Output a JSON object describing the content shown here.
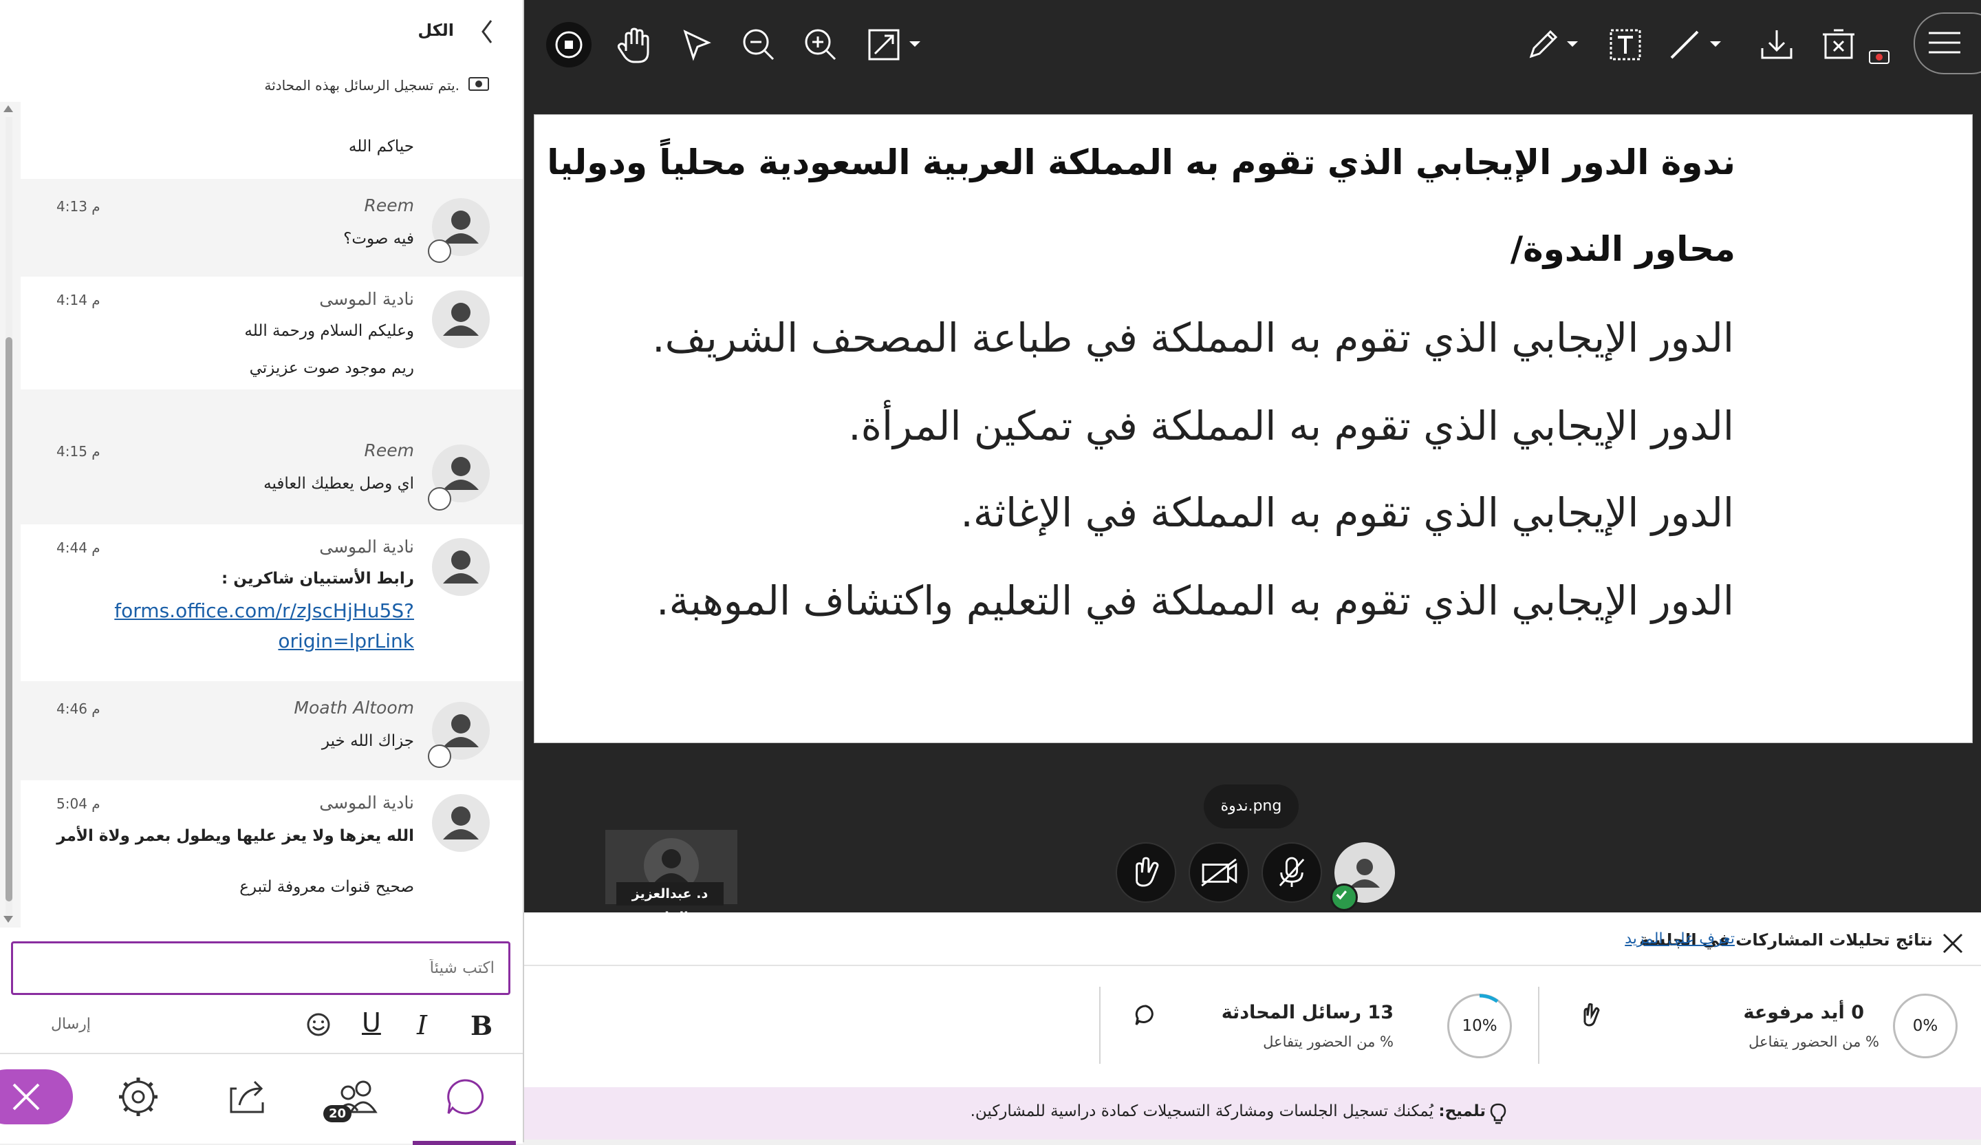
{
  "chat": {
    "header_title": "الكل",
    "recording_notice": "يتم تسجيل الرسائل بهذه المحادثة.",
    "messages": [
      {
        "name": "",
        "time": "",
        "lines": [
          "حياكم الله"
        ]
      },
      {
        "name": "Reem",
        "time": "4:13 م",
        "lines": [
          "فيه صوت؟"
        ]
      },
      {
        "name": "نادية الموسى",
        "time": "4:14 م",
        "lines": [
          "وعليكم السلام ورحمة الله",
          "ريم موجود صوت عزيزتي"
        ]
      },
      {
        "name": "Reem",
        "time": "4:15 م",
        "lines": [
          "اي وصل يعطيك العافيه"
        ]
      },
      {
        "name": "نادية الموسى",
        "time": "4:44 م",
        "lines": [
          "رابط الأستبيان شاكرين :"
        ],
        "link": [
          "forms.office.com/r/zJscHjHu5S?",
          "origin=lprLink"
        ]
      },
      {
        "name": "Moath Altoom",
        "time": "4:46 م",
        "lines": [
          "جزاك الله خير"
        ]
      },
      {
        "name": "نادية الموسى",
        "time": "5:04 م",
        "lines": [
          "الله يعزها ولا يعز عليها ويطول بعمر ولاة الأمر",
          "صحيح قنوات معروفة لتبرع"
        ]
      }
    ],
    "compose_placeholder": "اكتب شيئاً",
    "send_label": "إرسال",
    "participants_count": "20"
  },
  "slide": {
    "title": "ندوة الدور الإيجابي الذي تقوم به المملكة العربية السعودية محلياً ودوليا",
    "subtitle": "محاور الندوة/",
    "points": [
      "الدور الإيجابي الذي تقوم به المملكة في طباعة المصحف الشريف.",
      "الدور الإيجابي الذي تقوم به المملكة في تمكين المرأة.",
      "الدور الإيجابي الذي تقوم به المملكة في الإغاثة.",
      "الدور الإيجابي الذي تقوم به المملكة في التعليم واكتشاف الموهبة."
    ]
  },
  "stage": {
    "file_name": "ندوة.png",
    "presenter_name": "د. عبدالعزيز الفايز"
  },
  "analytics": {
    "title": "نتائج تحليلات المشاركات في الجلسة",
    "learn_more": "تعرف على المزيد",
    "hands_count": "0 أيد مرفوعة",
    "hands_percent": "0%",
    "hands_sub": "% من الحضور يتفاعل",
    "chat_count": "13 رسائل المحادثة",
    "chat_percent": "10%",
    "chat_percent_value": 10,
    "chat_sub": "% من الحضور يتفاعل"
  },
  "tip": {
    "label": "تلميح:",
    "text": "يُمكنك تسجيل الجلسات ومشاركة التسجيلات كمادة دراسية للمشاركين."
  },
  "colors": {
    "accent_purple": "#7b2a8f",
    "close_pink": "#b150c2",
    "stage_bg": "#262626",
    "progress_blue": "#1aa6d6",
    "link_blue": "#1a5fa8"
  }
}
